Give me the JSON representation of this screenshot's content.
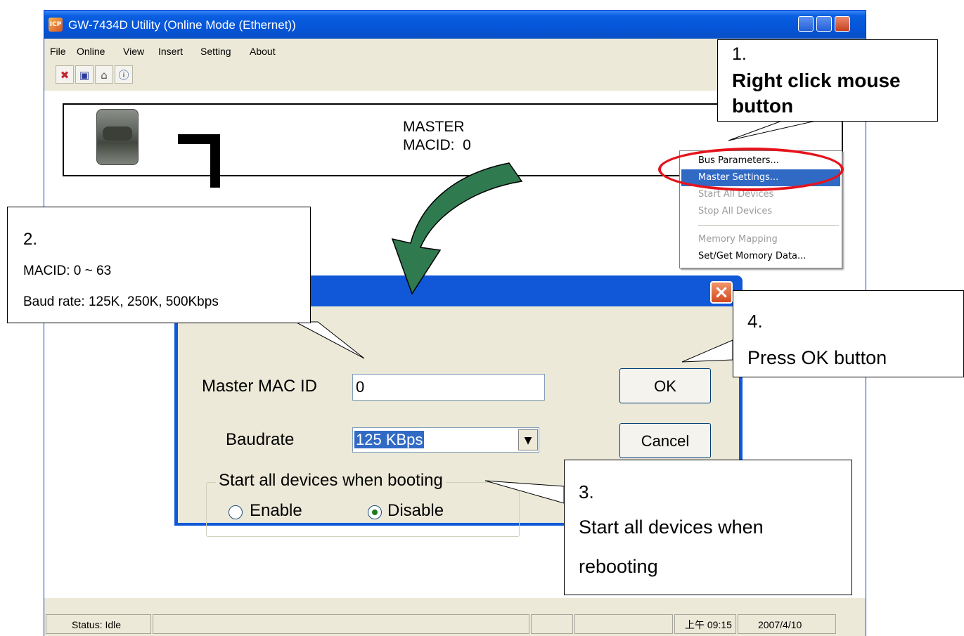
{
  "window": {
    "title": "GW-7434D Utility (Online Mode (Ethernet))",
    "icon_text": "ICP"
  },
  "menubar": [
    "File",
    "Online",
    "View",
    "Insert",
    "Setting",
    "About"
  ],
  "toolbar": {
    "icons": [
      "disconnect-icon",
      "save-icon",
      "open-icon",
      "about-icon"
    ],
    "glyphs": [
      "✖",
      "▣",
      "⌂",
      "ⓘ"
    ]
  },
  "canvas": {
    "master_label": "MASTER",
    "macid_label": "MACID:  0"
  },
  "context_menu": {
    "items": [
      {
        "label": "Bus Parameters...",
        "enabled": true,
        "selected": false
      },
      {
        "label": "Master Settings...",
        "enabled": true,
        "selected": true
      },
      {
        "label": "Start All Devices",
        "enabled": false,
        "selected": false
      },
      {
        "label": "Stop All Devices",
        "enabled": false,
        "selected": false
      },
      {
        "label": "Memory Mapping",
        "enabled": false,
        "selected": false
      },
      {
        "label": "Set/Get Momory Data...",
        "enabled": true,
        "selected": false
      }
    ]
  },
  "dialog": {
    "close_label": "×",
    "master_macid_label": "Master MAC ID",
    "master_macid_value": "0",
    "baudrate_label": "Baudrate",
    "baudrate_value": "125 KBps",
    "ok_label": "OK",
    "cancel_label": "Cancel",
    "group_title": "Start all devices when booting",
    "enable_label": "Enable",
    "disable_label": "Disable",
    "selected_option": "Disable"
  },
  "statusbar": {
    "status": "Status: Idle",
    "time": "上午 09:15",
    "date": "2007/4/10"
  },
  "callouts": {
    "c1": {
      "number": "1.",
      "text": "Right click mouse button"
    },
    "c2": {
      "number": "2.",
      "line1": "MACID: 0 ~ 63",
      "line2": "Baud rate: 125K, 250K, 500Kbps"
    },
    "c3": {
      "number": "3.",
      "line1": "Start all devices when",
      "line2": "rebooting"
    },
    "c4": {
      "number": "4.",
      "text": "Press OK button"
    }
  },
  "colors": {
    "titlebar": "#0555d9",
    "highlight": "#316ac5",
    "ellipse": "#e5141c",
    "arrow": "#2f7a4f"
  }
}
